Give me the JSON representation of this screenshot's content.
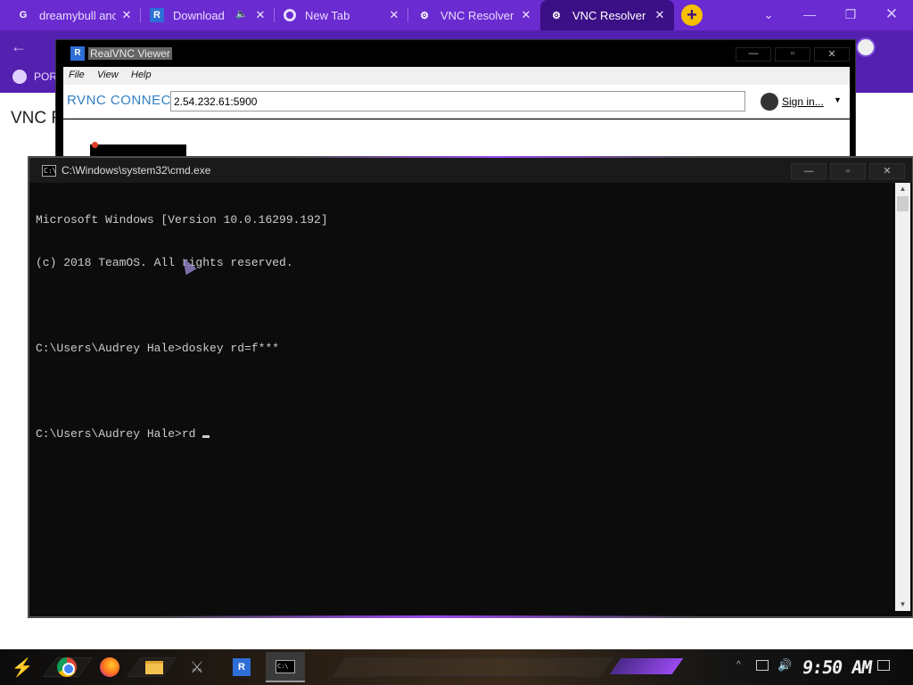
{
  "browser": {
    "tabs": [
      {
        "title": "dreamybull and",
        "icon": "google-icon"
      },
      {
        "title": "Download V",
        "icon": "realvnc-icon"
      },
      {
        "title": "New Tab",
        "icon": "chrome-icon"
      },
      {
        "title": "VNC Resolver",
        "icon": "vnc-resolver-icon"
      },
      {
        "title": "VNC Resolver",
        "icon": "vnc-resolver-icon",
        "active": true
      }
    ],
    "new_tab_label": "+",
    "bookmark_label": "POR",
    "page_heading": "VNC Re",
    "accent_color": "#6a2bd0",
    "new_tab_color": "#f6c000"
  },
  "vnc": {
    "title": "RealVNC Viewer",
    "menu": [
      "File",
      "View",
      "Help"
    ],
    "logo": "RVNC CONNECT",
    "address": "2.54.232.61:5900",
    "sign_in": "Sign in..."
  },
  "cmd": {
    "title": "C:\\Windows\\system32\\cmd.exe",
    "lines": [
      "Microsoft Windows [Version 10.0.16299.192]",
      "(c) 2018 TeamOS. All rights reserved.",
      "",
      "C:\\Users\\Audrey Hale>doskey rd=f***",
      "",
      "C:\\Users\\Audrey Hale>rd"
    ]
  },
  "taskbar": {
    "items": [
      "start-icon",
      "chrome-icon",
      "firefox-icon",
      "file-explorer-icon",
      "assassin-icon",
      "realvnc-icon",
      "cmd-icon"
    ],
    "clock": "9:50 AM"
  }
}
